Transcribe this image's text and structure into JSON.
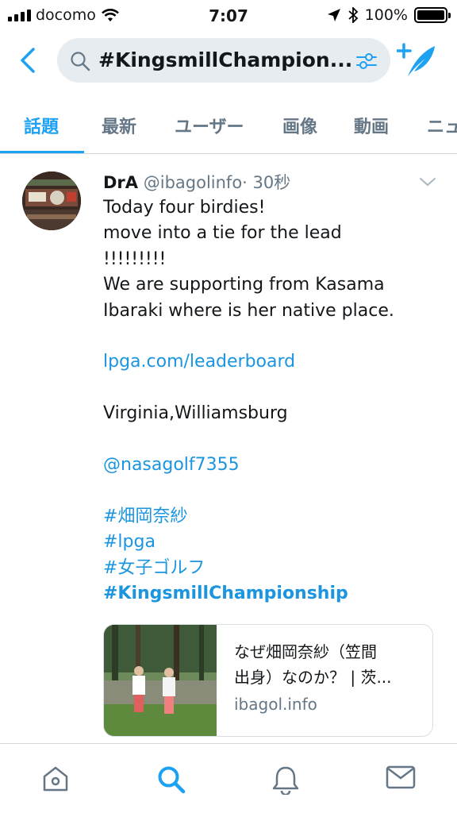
{
  "status_bar": {
    "carrier": "docomo",
    "time": "7:07",
    "battery": "100%"
  },
  "search": {
    "query": "#KingsmillChampion..."
  },
  "tabs": [
    {
      "label": "話題"
    },
    {
      "label": "最新"
    },
    {
      "label": "ユーザー"
    },
    {
      "label": "画像"
    },
    {
      "label": "動画"
    },
    {
      "label": "ニュ"
    }
  ],
  "tweet": {
    "name": "DrA",
    "handle": "@ibagolinfo",
    "separator": "·",
    "time": "30秒",
    "lines": [
      "Today four birdies!",
      "move into a tie for the lead",
      "!!!!!!!!!",
      "We are supporting from Kasama",
      "Ibaraki where is her native place.",
      "lpga.com/leaderboard",
      "Virginia,Williamsburg",
      "@nasagolf7355",
      "#畑岡奈紗",
      "#lpga",
      "#女子ゴルフ",
      "#KingsmillChampionship"
    ],
    "card": {
      "title_line1": "なぜ畑岡奈紗（笠間",
      "title_line2": "出身）なのか？ | 茨...",
      "domain": "ibagol.info"
    }
  },
  "icons": {
    "back": "chevron-left-icon",
    "search": "search-icon",
    "filter": "filter-sliders-icon",
    "compose": "compose-tweet-icon",
    "tweet_menu": "chevron-down-icon",
    "nav": [
      "home-icon",
      "search-icon",
      "bell-icon",
      "mail-icon"
    ]
  },
  "colors": {
    "accent": "#1da1f2",
    "link": "#1b95e0",
    "muted": "#657786",
    "searchbox": "#e6ecf0"
  }
}
